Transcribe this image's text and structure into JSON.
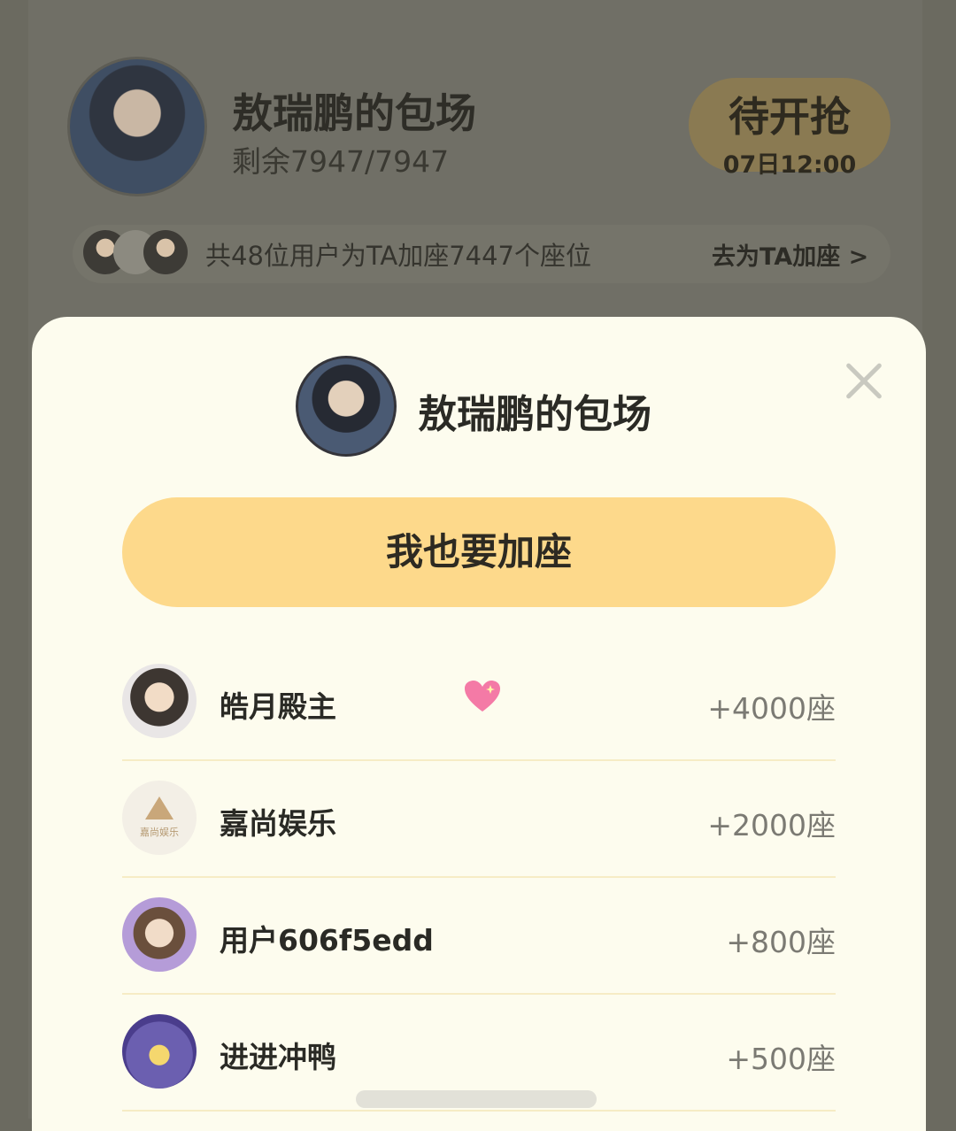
{
  "background": {
    "title": "敖瑞鹏的包场",
    "remaining": "剩余7947/7947",
    "grab_button": {
      "label": "待开抢",
      "time": "07日12:00"
    },
    "supporters_text": "共48位用户为TA加座7447个座位",
    "add_link": "去为TA加座 >"
  },
  "modal": {
    "title": "敖瑞鹏的包场",
    "add_button": "我也要加座",
    "list": [
      {
        "name": "皓月殿主",
        "seats": "+4000座"
      },
      {
        "name": "嘉尚娱乐",
        "seats": "+2000座"
      },
      {
        "name": "用户606f5edd",
        "seats": "+800座"
      },
      {
        "name": "进进冲鸭",
        "seats": "+500座"
      }
    ],
    "logo_text": "嘉尚娱乐"
  },
  "colors": {
    "accent": "#fdd98b",
    "modal_bg": "#fdfcee",
    "overlay": "#6b6a60"
  }
}
